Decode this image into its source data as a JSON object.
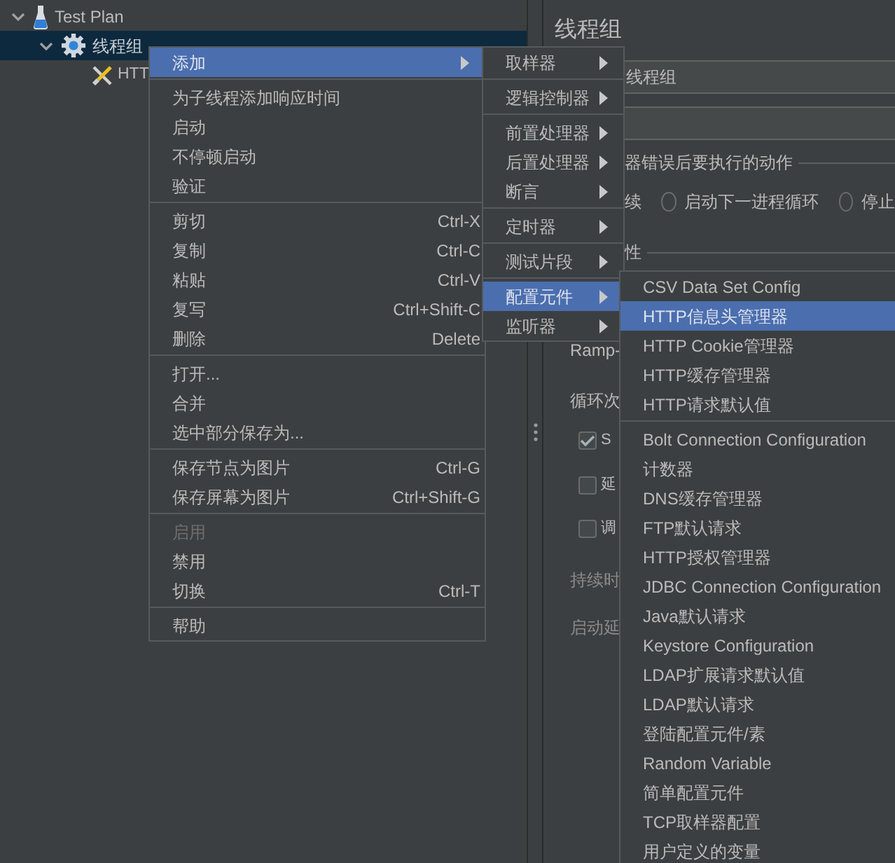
{
  "tree": [
    {
      "label": "Test Plan",
      "expanded": true,
      "selected": false,
      "children": [
        {
          "label": "线程组",
          "expanded": true,
          "selected": true,
          "children": [
            {
              "label": "HTT",
              "selected": false
            }
          ]
        }
      ]
    }
  ],
  "panel": {
    "title": "线程组",
    "name_value": "线程组",
    "error_group_label": "器错误后要执行的动作",
    "error_option_fragment": "续",
    "error_options": [
      {
        "label": "启动下一进程循环",
        "selected": false
      },
      {
        "label": "停止",
        "selected": false
      }
    ],
    "thread_group_label": "性",
    "rows": [
      {
        "kind": "text",
        "label": "Ramp-",
        "disabled": false
      },
      {
        "kind": "text",
        "label": "循环次",
        "disabled": false
      },
      {
        "kind": "checkbox",
        "label": "S",
        "checked": true
      },
      {
        "kind": "checkbox",
        "label": "延",
        "checked": false
      },
      {
        "kind": "checkbox",
        "label": "调",
        "checked": false
      },
      {
        "kind": "text",
        "label": "持续时",
        "disabled": true
      },
      {
        "kind": "text",
        "label": "启动延",
        "disabled": true
      }
    ]
  },
  "context_menu": [
    {
      "kind": "item",
      "label": "添加",
      "selected": true,
      "submenu": true
    },
    {
      "kind": "separator"
    },
    {
      "kind": "item",
      "label": "为子线程添加响应时间",
      "selected": false
    },
    {
      "kind": "item",
      "label": "启动",
      "selected": false
    },
    {
      "kind": "item",
      "label": "不停顿启动",
      "selected": false
    },
    {
      "kind": "item",
      "label": "验证",
      "selected": false
    },
    {
      "kind": "separator"
    },
    {
      "kind": "item",
      "label": "剪切",
      "shortcut": "Ctrl-X",
      "selected": false
    },
    {
      "kind": "item",
      "label": "复制",
      "shortcut": "Ctrl-C",
      "selected": false
    },
    {
      "kind": "item",
      "label": "粘贴",
      "shortcut": "Ctrl-V",
      "selected": false
    },
    {
      "kind": "item",
      "label": "复写",
      "shortcut": "Ctrl+Shift-C",
      "selected": false
    },
    {
      "kind": "item",
      "label": "删除",
      "shortcut": "Delete",
      "selected": false
    },
    {
      "kind": "separator"
    },
    {
      "kind": "item",
      "label": "打开...",
      "selected": false
    },
    {
      "kind": "item",
      "label": "合并",
      "selected": false
    },
    {
      "kind": "item",
      "label": "选中部分保存为...",
      "selected": false
    },
    {
      "kind": "separator"
    },
    {
      "kind": "item",
      "label": "保存节点为图片",
      "shortcut": "Ctrl-G",
      "selected": false
    },
    {
      "kind": "item",
      "label": "保存屏幕为图片",
      "shortcut": "Ctrl+Shift-G",
      "selected": false
    },
    {
      "kind": "separator"
    },
    {
      "kind": "item",
      "label": "启用",
      "selected": false,
      "disabled": true
    },
    {
      "kind": "item",
      "label": "禁用",
      "selected": false
    },
    {
      "kind": "item",
      "label": "切换",
      "shortcut": "Ctrl-T",
      "selected": false
    },
    {
      "kind": "separator"
    },
    {
      "kind": "item",
      "label": "帮助",
      "selected": false
    }
  ],
  "add_submenu": [
    {
      "kind": "item",
      "label": "取样器",
      "selected": false,
      "submenu": true
    },
    {
      "kind": "separator"
    },
    {
      "kind": "item",
      "label": "逻辑控制器",
      "selected": false,
      "submenu": true
    },
    {
      "kind": "separator"
    },
    {
      "kind": "item",
      "label": "前置处理器",
      "selected": false,
      "submenu": true
    },
    {
      "kind": "item",
      "label": "后置处理器",
      "selected": false,
      "submenu": true
    },
    {
      "kind": "item",
      "label": "断言",
      "selected": false,
      "submenu": true
    },
    {
      "kind": "separator"
    },
    {
      "kind": "item",
      "label": "定时器",
      "selected": false,
      "submenu": true
    },
    {
      "kind": "separator"
    },
    {
      "kind": "item",
      "label": "测试片段",
      "selected": false,
      "submenu": true
    },
    {
      "kind": "separator"
    },
    {
      "kind": "item",
      "label": "配置元件",
      "selected": true,
      "submenu": true
    },
    {
      "kind": "item",
      "label": "监听器",
      "selected": false,
      "submenu": true
    }
  ],
  "config_submenu": [
    {
      "kind": "item",
      "label": "CSV Data Set Config",
      "selected": false
    },
    {
      "kind": "item",
      "label": "HTTP信息头管理器",
      "selected": true
    },
    {
      "kind": "item",
      "label": "HTTP Cookie管理器",
      "selected": false
    },
    {
      "kind": "item",
      "label": "HTTP缓存管理器",
      "selected": false
    },
    {
      "kind": "item",
      "label": "HTTP请求默认值",
      "selected": false
    },
    {
      "kind": "separator"
    },
    {
      "kind": "item",
      "label": "Bolt Connection Configuration",
      "selected": false
    },
    {
      "kind": "item",
      "label": "计数器",
      "selected": false
    },
    {
      "kind": "item",
      "label": "DNS缓存管理器",
      "selected": false
    },
    {
      "kind": "item",
      "label": "FTP默认请求",
      "selected": false
    },
    {
      "kind": "item",
      "label": "HTTP授权管理器",
      "selected": false
    },
    {
      "kind": "item",
      "label": "JDBC Connection Configuration",
      "selected": false
    },
    {
      "kind": "item",
      "label": "Java默认请求",
      "selected": false
    },
    {
      "kind": "item",
      "label": "Keystore Configuration",
      "selected": false
    },
    {
      "kind": "item",
      "label": "LDAP扩展请求默认值",
      "selected": false
    },
    {
      "kind": "item",
      "label": "LDAP默认请求",
      "selected": false
    },
    {
      "kind": "item",
      "label": "登陆配置元件/素",
      "selected": false
    },
    {
      "kind": "item",
      "label": "Random Variable",
      "selected": false
    },
    {
      "kind": "item",
      "label": "简单配置元件",
      "selected": false
    },
    {
      "kind": "item",
      "label": "TCP取样器配置",
      "selected": false
    },
    {
      "kind": "item",
      "label": "用户定义的变量",
      "selected": false
    }
  ]
}
